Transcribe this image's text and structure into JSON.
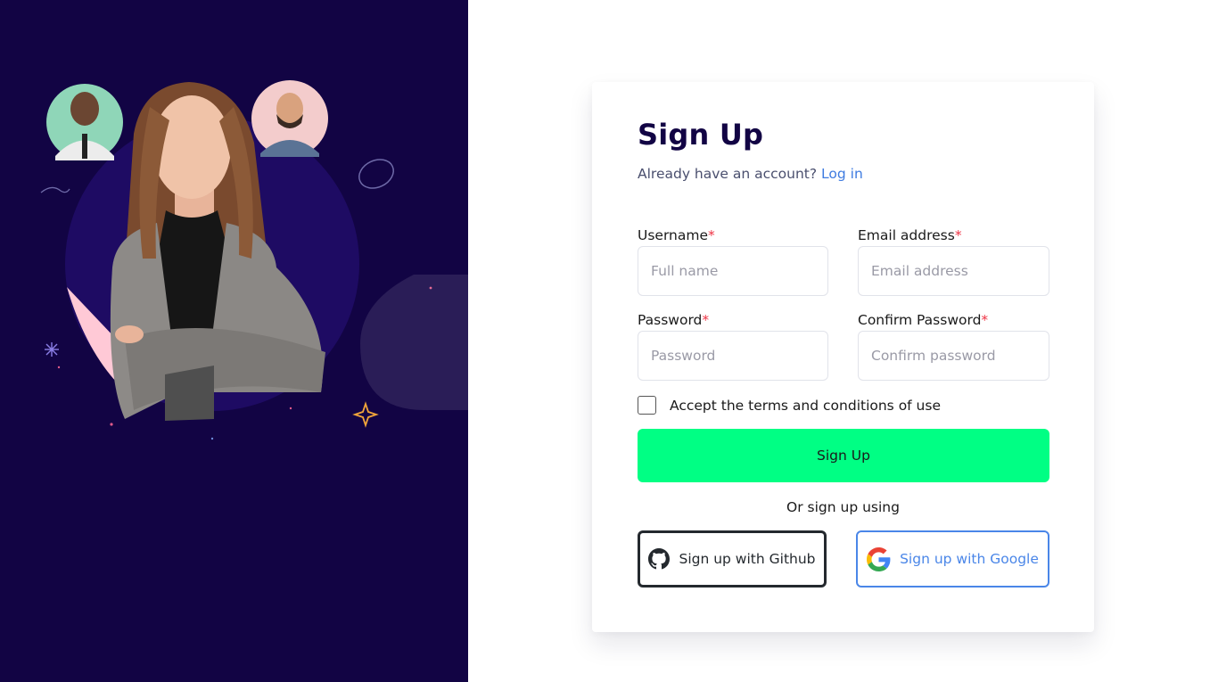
{
  "page": {
    "title": "Sign Up",
    "subtitle_prefix": "Already have an account?",
    "login_link": "Log in"
  },
  "form": {
    "username": {
      "label": "Username",
      "required_mark": "*",
      "placeholder": "Full name",
      "value": ""
    },
    "email": {
      "label": "Email address",
      "required_mark": "*",
      "placeholder": "Email address",
      "value": ""
    },
    "password": {
      "label": "Password",
      "required_mark": "*",
      "placeholder": "Password",
      "value": ""
    },
    "confirm_password": {
      "label": "Confirm Password",
      "required_mark": "*",
      "placeholder": "Confirm password",
      "value": ""
    },
    "terms_label": "Accept the terms and conditions of use",
    "terms_checked": false,
    "submit_label": "Sign Up"
  },
  "social": {
    "divider_text": "Or sign up using",
    "github_label": "Sign up with Github",
    "github_icon": "github-icon",
    "google_label": "Sign up with Google",
    "google_icon": "google-icon"
  },
  "colors": {
    "hero_background": "#120444",
    "title": "#120444",
    "link": "#3e7be0",
    "primary_button": "#00ff84",
    "required_mark": "#ee3344",
    "github_border": "#24292e",
    "google_border": "#4a86e8"
  }
}
